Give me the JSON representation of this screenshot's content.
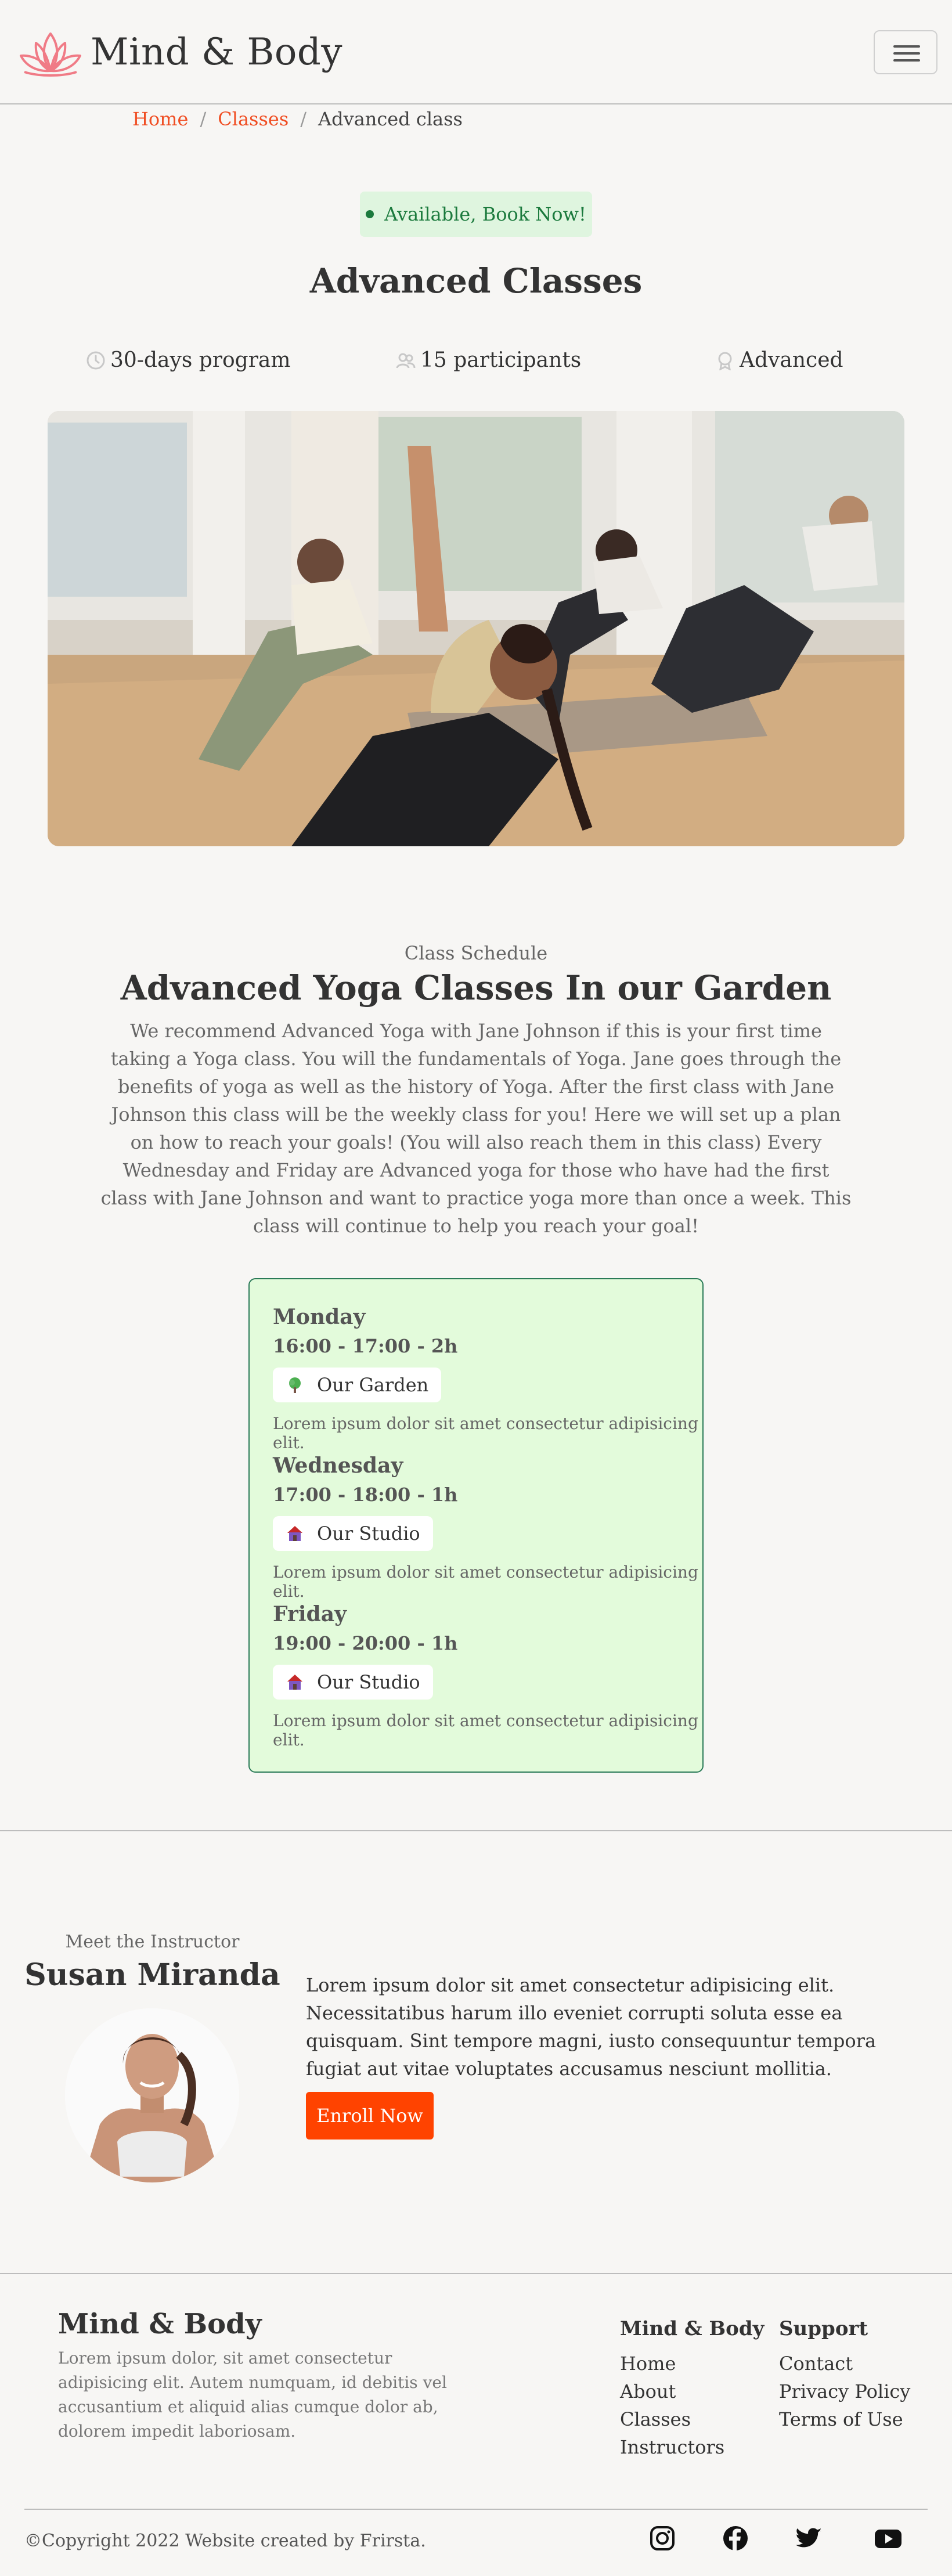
{
  "header": {
    "brand": "Mind & Body",
    "menu_icon": "hamburger-menu-icon"
  },
  "breadcrumb": {
    "home": "Home",
    "classes": "Classes",
    "current": "Advanced class",
    "separator": "/"
  },
  "badge": {
    "label": "Available, Book Now!",
    "color": "#1b7a3d"
  },
  "class": {
    "title": "Advanced Classes",
    "duration": "30-days program",
    "participants": "15 participants",
    "level": "Advanced"
  },
  "schedule": {
    "eyebrow": "Class Schedule",
    "title": "Advanced Yoga Classes In our Garden",
    "description": "We recommend Advanced Yoga with Jane Johnson if this is your first time taking a Yoga class. You will the fundamentals of Yoga. Jane goes through the benefits of yoga as well as the history of Yoga. After the first class with Jane Johnson this class will be the weekly class for you! Here we will set up a plan on how to reach your goals! (You will also reach them in this class) Every Wednesday and Friday are Advanced yoga for those who have had the first class with Jane Johnson and want to practice yoga more than once a week. This class will continue to help you reach your goal!",
    "days": [
      {
        "day": "Monday",
        "time": "16:00 - 17:00 - 2h",
        "place": "Our Garden",
        "icon": "tree-icon",
        "note": "Lorem ipsum dolor sit amet consectetur adipisicing elit."
      },
      {
        "day": "Wednesday",
        "time": "17:00 - 18:00 - 1h",
        "place": "Our Studio",
        "icon": "house-icon",
        "note": "Lorem ipsum dolor sit amet consectetur adipisicing elit."
      },
      {
        "day": "Friday",
        "time": "19:00 - 20:00 - 1h",
        "place": "Our Studio",
        "icon": "house-icon",
        "note": "Lorem ipsum dolor sit amet consectetur adipisicing elit."
      }
    ]
  },
  "instructor": {
    "eyebrow": "Meet the Instructor",
    "name": "Susan Miranda",
    "bio": "Lorem ipsum dolor sit amet consectetur adipisicing elit. Necessitatibus harum illo eveniet corrupti soluta esse ea quisquam. Sint tempore magni, iusto consequuntur tempora fugiat aut vitae voluptates accusamus nesciunt mollitia.",
    "cta": "Enroll Now"
  },
  "footer": {
    "brand": "Mind & Body",
    "description": "Lorem ipsum dolor, sit amet consectetur adipisicing elit. Autem numquam, id debitis vel accusantium et aliquid alias cumque dolor ab, dolorem impedit laboriosam.",
    "col1": {
      "heading": "Mind & Body",
      "links": [
        "Home",
        "About",
        "Classes",
        "Instructors"
      ]
    },
    "col2": {
      "heading": "Support",
      "links": [
        "Contact",
        "Privacy Policy",
        "Terms of Use"
      ]
    },
    "copyright": "©Copyright 2022 Website created by Frirsta.",
    "socials": [
      "instagram-icon",
      "facebook-icon",
      "twitter-icon",
      "youtube-icon"
    ]
  },
  "colors": {
    "accent": "#f04e23",
    "cta": "#ff4300",
    "card_bg": "#e3fbdb",
    "card_border": "#2a7a57",
    "page_bg": "#f7f6f4"
  }
}
